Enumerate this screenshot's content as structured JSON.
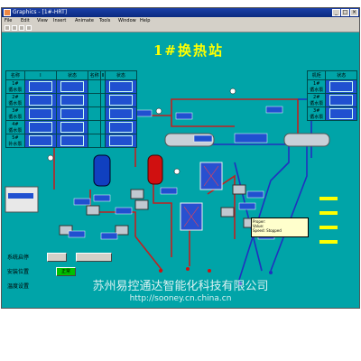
{
  "window": {
    "title": "Graphics - [1#-HRT]",
    "menu": [
      "File",
      "Edit",
      "View",
      "Insert",
      "Animate",
      "Tools",
      "Window",
      "Help"
    ]
  },
  "station_title": "1#换热站",
  "left_table": {
    "headers": [
      "名称",
      "Ⅰ",
      "状态",
      "名称",
      "Ⅱ",
      "状态"
    ],
    "rows": [
      {
        "name": "1#\n循水泵"
      },
      {
        "name": "2#\n循水泵"
      },
      {
        "name": "3#\n循水泵"
      },
      {
        "name": "4#\n循水泵"
      },
      {
        "name": "5#\n补水泵"
      }
    ]
  },
  "right_table": {
    "headers": [
      "机柜",
      "状态"
    ],
    "rows": [
      {
        "name": "1#\n循水泵"
      },
      {
        "name": "2#\n循水泵"
      },
      {
        "name": "3#\n循水泵"
      }
    ]
  },
  "control_panel": {
    "rows": [
      {
        "label": "系统启停"
      },
      {
        "label": "安装位置",
        "button": "正常"
      },
      {
        "label": "温度设置"
      }
    ]
  },
  "status_popup": {
    "lines": [
      "Proper: ",
      "Value: ",
      "Speed: Stopped"
    ]
  },
  "watermark": {
    "line1": "苏州易控通达智能化科技有限公司",
    "line2": "http://sooney.cn.china.cn"
  },
  "colors": {
    "background": "#00a4a8",
    "supply_pipe": "#c02020",
    "return_pipe": "#2030c0",
    "title": "#ffff00",
    "tank_red": "#d01010",
    "tank_blue": "#1040c0"
  }
}
